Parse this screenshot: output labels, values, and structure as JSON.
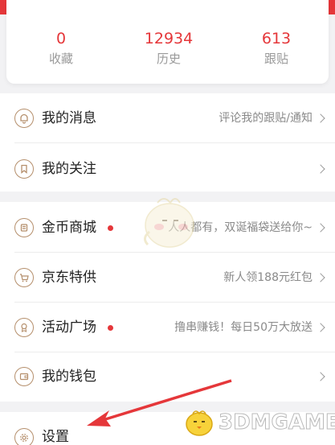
{
  "stats": [
    {
      "value": "0",
      "label": "收藏"
    },
    {
      "value": "12934",
      "label": "历史"
    },
    {
      "value": "613",
      "label": "跟贴"
    }
  ],
  "menu": {
    "messages": {
      "title": "我的消息",
      "sub": "评论我的跟贴/通知",
      "icon": "bell-icon"
    },
    "follows": {
      "title": "我的关注",
      "sub": "",
      "icon": "bookmark-icon"
    },
    "coin_mall": {
      "title": "金币商城",
      "sub": "人人都有，双诞福袋送给你~",
      "icon": "coin-icon",
      "has_dot": true
    },
    "jd": {
      "title": "京东特供",
      "sub": "新人领188元红包",
      "icon": "cart-icon"
    },
    "events": {
      "title": "活动广场",
      "sub": "撸串赚钱！每日50万大放送",
      "icon": "medal-icon",
      "has_dot": true
    },
    "wallet": {
      "title": "我的钱包",
      "sub": "",
      "icon": "wallet-icon"
    },
    "settings": {
      "title": "设置",
      "sub": "",
      "icon": "gear-icon"
    }
  },
  "watermark": {
    "text": "3DMGAME"
  },
  "colors": {
    "accent": "#e5373a",
    "icon": "#b58f6c",
    "background": "#f2f2f4"
  }
}
